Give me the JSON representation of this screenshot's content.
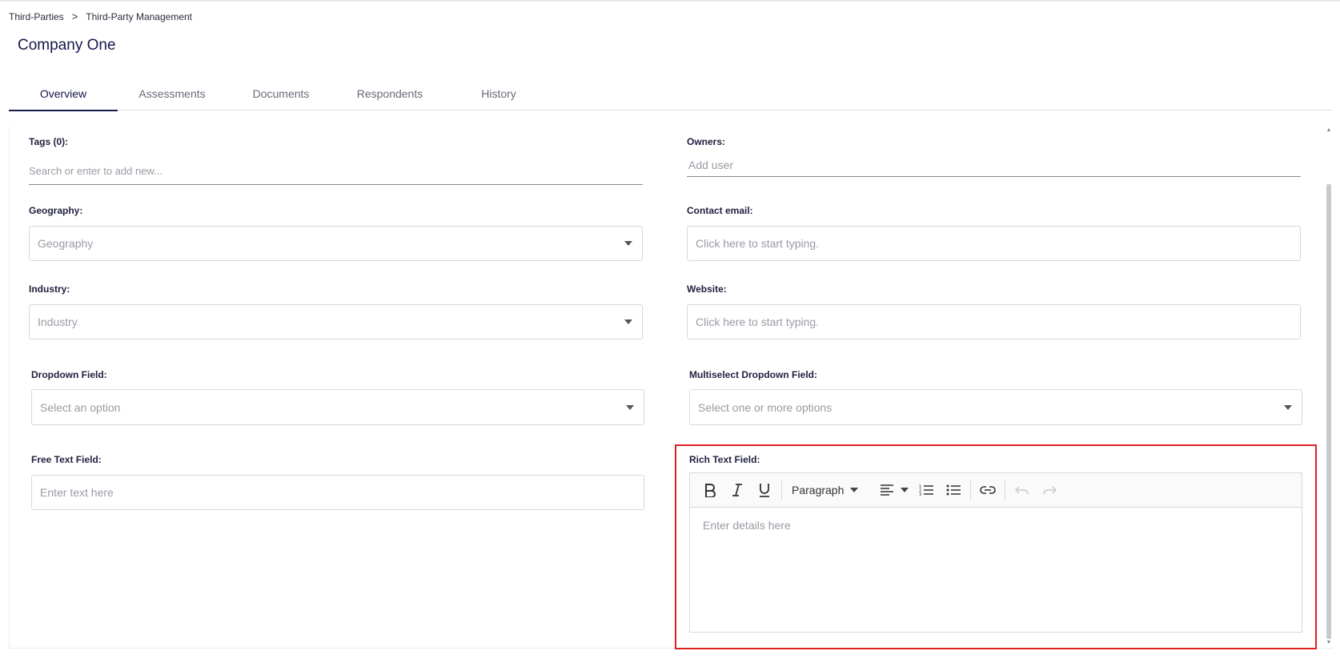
{
  "breadcrumb": {
    "items": [
      "Third-Parties",
      "Third-Party Management"
    ],
    "separator": ">"
  },
  "page": {
    "title": "Company One"
  },
  "tabs": [
    {
      "label": "Overview",
      "active": true
    },
    {
      "label": "Assessments",
      "active": false
    },
    {
      "label": "Documents",
      "active": false
    },
    {
      "label": "Respondents",
      "active": false
    },
    {
      "label": "History",
      "active": false
    }
  ],
  "fields": {
    "tags": {
      "label": "Tags (0):",
      "placeholder": "Search or enter to add new..."
    },
    "owners": {
      "label": "Owners:",
      "placeholder": "Add user"
    },
    "geography": {
      "label": "Geography:",
      "placeholder": "Geography"
    },
    "contact_email": {
      "label": "Contact email:",
      "placeholder": "Click here to start typing."
    },
    "industry": {
      "label": "Industry:",
      "placeholder": "Industry"
    },
    "website": {
      "label": "Website:",
      "placeholder": "Click here to start typing."
    },
    "dropdown": {
      "label": "Dropdown Field:",
      "placeholder": "Select an option"
    },
    "multiselect": {
      "label": "Multiselect Dropdown Field:",
      "placeholder": "Select one or more options"
    },
    "free_text": {
      "label": "Free Text Field:",
      "placeholder": "Enter text here"
    },
    "rich_text": {
      "label": "Rich Text Field:",
      "placeholder": "Enter details here",
      "toolbar": {
        "paragraph_label": "Paragraph"
      }
    }
  },
  "colors": {
    "highlight": "#e02020",
    "accent": "#1c1c55"
  }
}
